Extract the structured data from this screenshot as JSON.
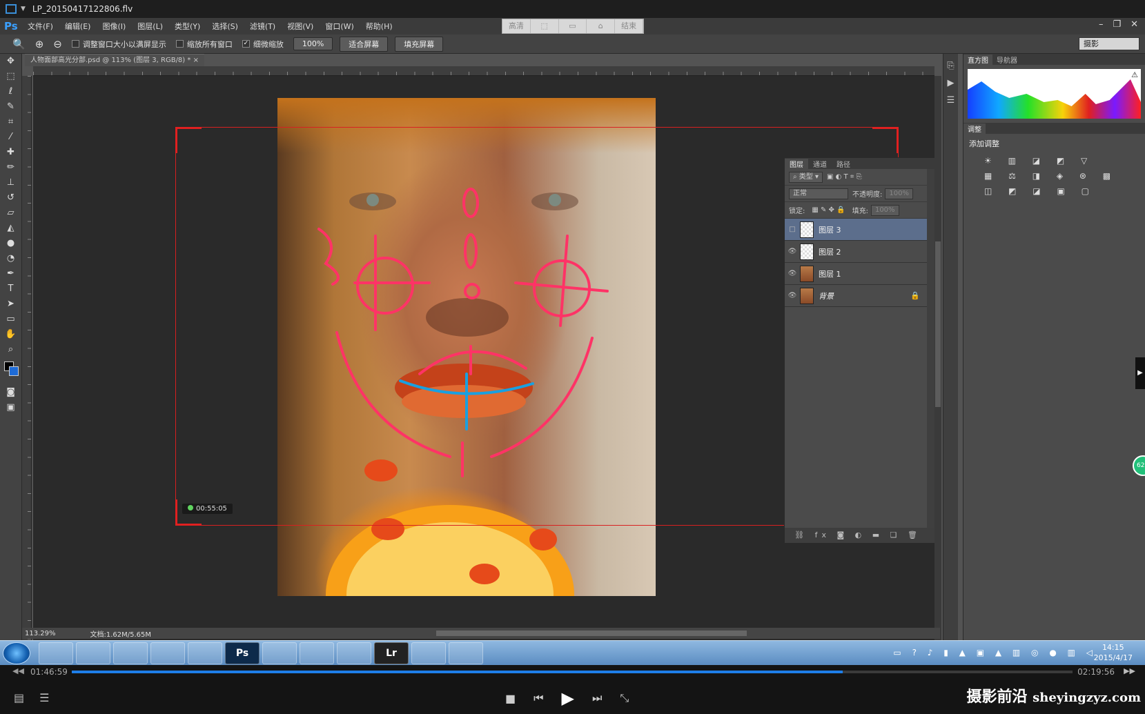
{
  "player": {
    "filename": "LP_20150417122806.flv",
    "time_current": "01:46:59",
    "time_total": "02:19:56",
    "progress": 0.77,
    "watermark_cn": "摄影前沿",
    "watermark_url": "sheyingzyz.com"
  },
  "ps": {
    "logo": "Ps",
    "menus": [
      "文件(F)",
      "编辑(E)",
      "图像(I)",
      "图层(L)",
      "类型(Y)",
      "选择(S)",
      "滤镜(T)",
      "视图(V)",
      "窗口(W)",
      "帮助(H)"
    ],
    "center_bar": [
      "高清",
      "",
      "",
      "",
      "结束"
    ],
    "options": {
      "fit_window": "调整窗口大小以满屏显示",
      "zoom_all": "缩放所有窗口",
      "scrubby": "细微缩放",
      "zoom_pct": "100%",
      "fit_screen": "适合屏幕",
      "fill_screen": "填充屏幕"
    },
    "workspace": "摄影",
    "doc_tab": "人物面部高光分部.psd @ 113% (图层 3, RGB/8) *",
    "timestamp": "00:55:05",
    "status_zoom": "113.29%",
    "status_doc": "文档:1.62M/5.65M"
  },
  "layers_panel": {
    "tabs": [
      "图层",
      "通道",
      "路径"
    ],
    "filter": "类型",
    "blend": "正常",
    "opacity_label": "不透明度:",
    "opacity_val": "100%",
    "lock_label": "锁定:",
    "fill_label": "填充:",
    "fill_val": "100%",
    "layers": [
      {
        "name": "图层 3"
      },
      {
        "name": "图层 2"
      },
      {
        "name": "图层 1"
      },
      {
        "name": "背景"
      }
    ],
    "footer_icons": "⛓ fx ◙ ◐ ▬ ❏ 🗑"
  },
  "right_panel": {
    "tabs": [
      "直方图",
      "导航器"
    ],
    "adj_tab": "调整",
    "adj_title": "添加调整"
  },
  "taskbar": {
    "apps": [
      "",
      "",
      "",
      "",
      "",
      "Ps",
      "",
      "",
      "",
      "Lr",
      "",
      ""
    ],
    "time": "14:15",
    "date": "2015/4/17"
  },
  "badge": "62"
}
